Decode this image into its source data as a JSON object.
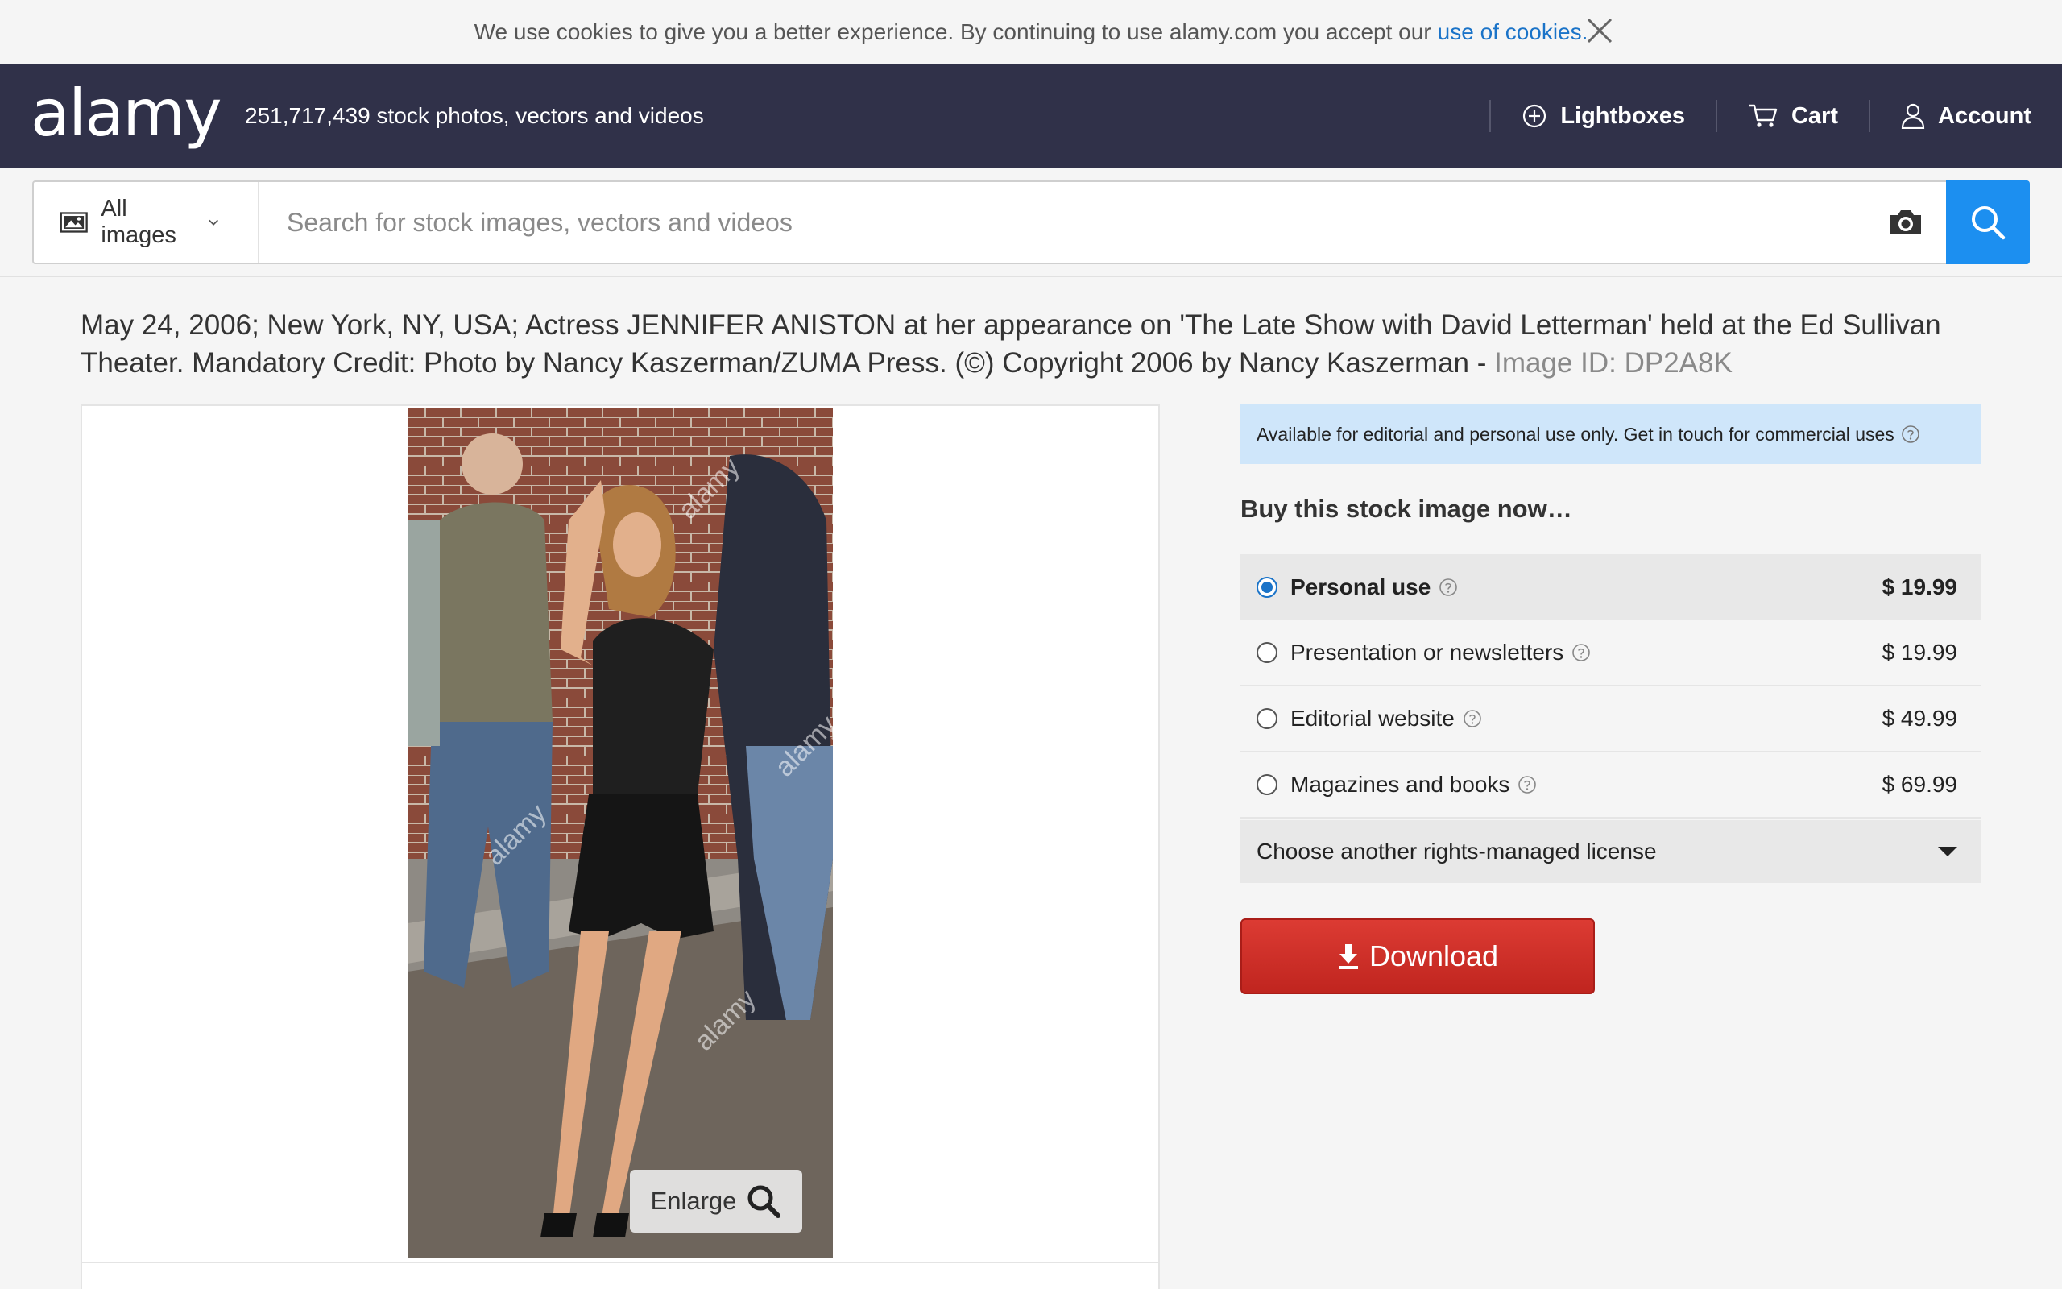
{
  "cookie_bar": {
    "text": "We use cookies to give you a better experience. By continuing to use alamy.com you accept our",
    "link": "use of cookies."
  },
  "header": {
    "logo": "alamy",
    "tagline": "251,717,439 stock photos, vectors and videos",
    "nav": {
      "lightboxes": "Lightboxes",
      "cart": "Cart",
      "account": "Account"
    }
  },
  "search": {
    "scope": "All images",
    "placeholder": "Search for stock images, vectors and videos"
  },
  "image": {
    "title": "May 24, 2006; New York, NY, USA; Actress JENNIFER ANISTON at her appearance on 'The Late Show with David Letterman' held at the Ed Sullivan Theater. Mandatory Credit: Photo by Nancy Kaszerman/ZUMA Press. (©) Copyright 2006 by Nancy Kaszerman -",
    "image_id": "Image ID: DP2A8K",
    "enlarge": "Enlarge",
    "watermark": "alamy"
  },
  "purchase": {
    "notice": "Available for editorial and personal use only. Get in touch for commercial uses",
    "heading": "Buy this stock image now…",
    "options": [
      {
        "label": "Personal use",
        "price": "$ 19.99",
        "selected": true
      },
      {
        "label": "Presentation or newsletters",
        "price": "$ 19.99",
        "selected": false
      },
      {
        "label": "Editorial website",
        "price": "$ 49.99",
        "selected": false
      },
      {
        "label": "Magazines and books",
        "price": "$ 69.99",
        "selected": false
      }
    ],
    "license_select": "Choose another rights-managed license",
    "download": "Download"
  },
  "colors": {
    "header_bg": "#303149",
    "accent_blue": "#1c8ff0",
    "download_red": "#d0302a",
    "notice_bg": "#cfe6fa"
  }
}
